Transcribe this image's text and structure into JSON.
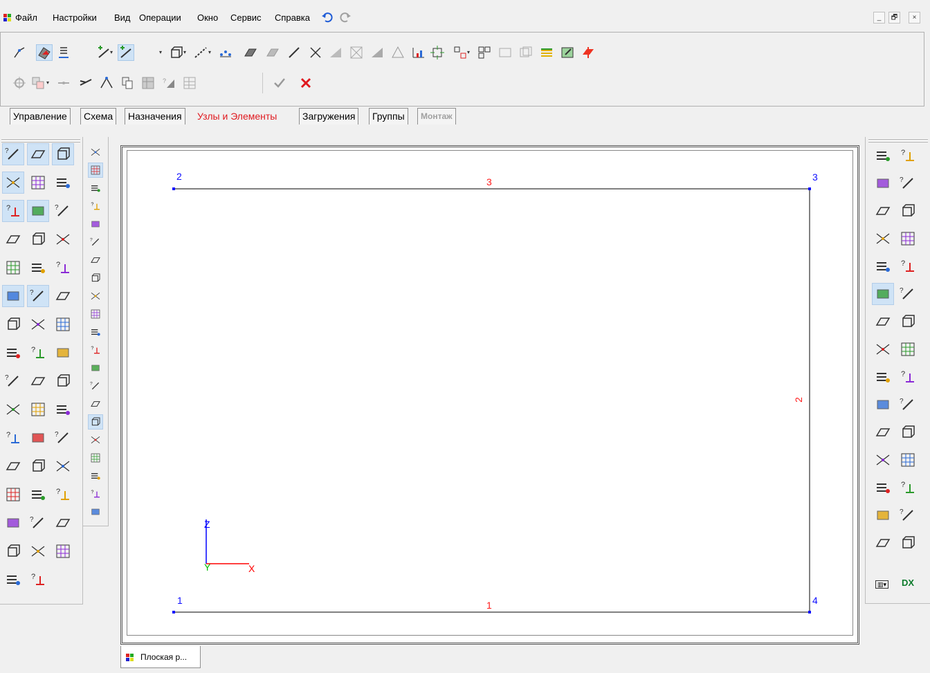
{
  "menu": {
    "items": [
      "Файл",
      "Настройки",
      "Вид",
      "Операции",
      "Окно",
      "Сервис",
      "Справка"
    ]
  },
  "window_controls": {
    "minimize": "_",
    "restore": "🗗",
    "close": "×"
  },
  "tabs": [
    {
      "label": "Управление",
      "state": "normal"
    },
    {
      "label": "Схема",
      "state": "normal"
    },
    {
      "label": "Назначения",
      "state": "normal"
    },
    {
      "label": "Узлы и Элементы",
      "state": "active"
    },
    {
      "label": "Загружения",
      "state": "normal"
    },
    {
      "label": "Группы",
      "state": "normal"
    },
    {
      "label": "Монтаж",
      "state": "disabled"
    }
  ],
  "toolbar": {
    "confirm_icon": "check-icon",
    "cancel_icon": "cross-icon"
  },
  "canvas": {
    "nodes": [
      {
        "label": "1"
      },
      {
        "label": "2"
      },
      {
        "label": "3"
      },
      {
        "label": "4"
      }
    ],
    "elements": [
      {
        "label": "1"
      },
      {
        "label": "2"
      },
      {
        "label": "3"
      }
    ],
    "axes": {
      "x": "X",
      "y": "Y",
      "z": "Z"
    },
    "colors": {
      "node": "#1010ff",
      "element": "#ff1a1a",
      "axis_x": "#ff0000",
      "axis_y": "#00c000",
      "axis_z": "#0000ff"
    }
  },
  "right_panel": {
    "dx_label": "DX"
  },
  "document_tab": {
    "label": "Плоская р..."
  }
}
